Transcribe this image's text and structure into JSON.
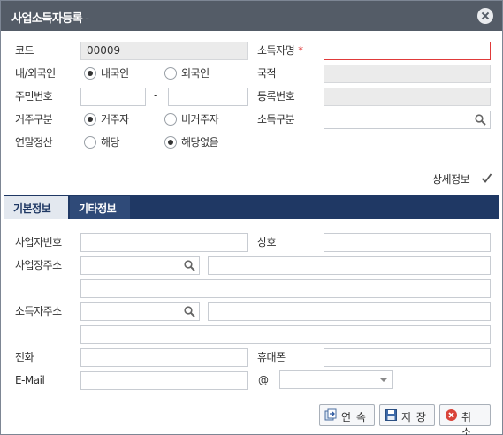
{
  "window": {
    "title": "사업소득자등록",
    "title_suffix": "-"
  },
  "form": {
    "code": {
      "label": "코드",
      "value": "00009"
    },
    "earner_name": {
      "label": "소득자명",
      "required_mark": "*",
      "value": ""
    },
    "residency_type": {
      "label": "내/외국인",
      "options": [
        "내국인",
        "외국인"
      ],
      "selected": "내국인"
    },
    "nationality": {
      "label": "국적",
      "value": ""
    },
    "resident_no": {
      "label": "주민번호",
      "part1": "",
      "separator": "-",
      "part2": ""
    },
    "registration_no": {
      "label": "등록번호",
      "value": ""
    },
    "domicile": {
      "label": "거주구분",
      "options": [
        "거주자",
        "비거주자"
      ],
      "selected": "거주자"
    },
    "income_type": {
      "label": "소득구분",
      "value": ""
    },
    "year_end_settlement": {
      "label": "연말정산",
      "options": [
        "해당",
        "해당없음"
      ],
      "selected": "해당없음"
    },
    "detail_toggle": {
      "label": "상세정보",
      "checked": true
    }
  },
  "tabs": [
    {
      "label": "기본정보",
      "active": true
    },
    {
      "label": "기타정보",
      "active": false
    }
  ],
  "basic_info": {
    "business_no": {
      "label": "사업자번호",
      "value": ""
    },
    "trade_name": {
      "label": "상호",
      "value": ""
    },
    "business_address": {
      "label": "사업장주소",
      "zip": "",
      "address1": "",
      "address2": ""
    },
    "earner_address": {
      "label": "소득자주소",
      "zip": "",
      "address1": "",
      "address2": ""
    },
    "phone": {
      "label": "전화",
      "value": ""
    },
    "mobile": {
      "label": "휴대폰",
      "value": ""
    },
    "email": {
      "label": "E-Mail",
      "local": "",
      "at": "@",
      "domain": ""
    }
  },
  "buttons": {
    "continue": "연 속",
    "save": "저 장",
    "cancel": "취 소"
  },
  "colors": {
    "titlebar": "#545c67",
    "tab_bar": "#1f3864",
    "required": "#e03a3a",
    "disabled_field": "#ebebeb"
  },
  "icons": [
    "close-icon",
    "search-icon",
    "checkmark-icon",
    "continue-icon",
    "save-icon",
    "cancel-icon"
  ]
}
